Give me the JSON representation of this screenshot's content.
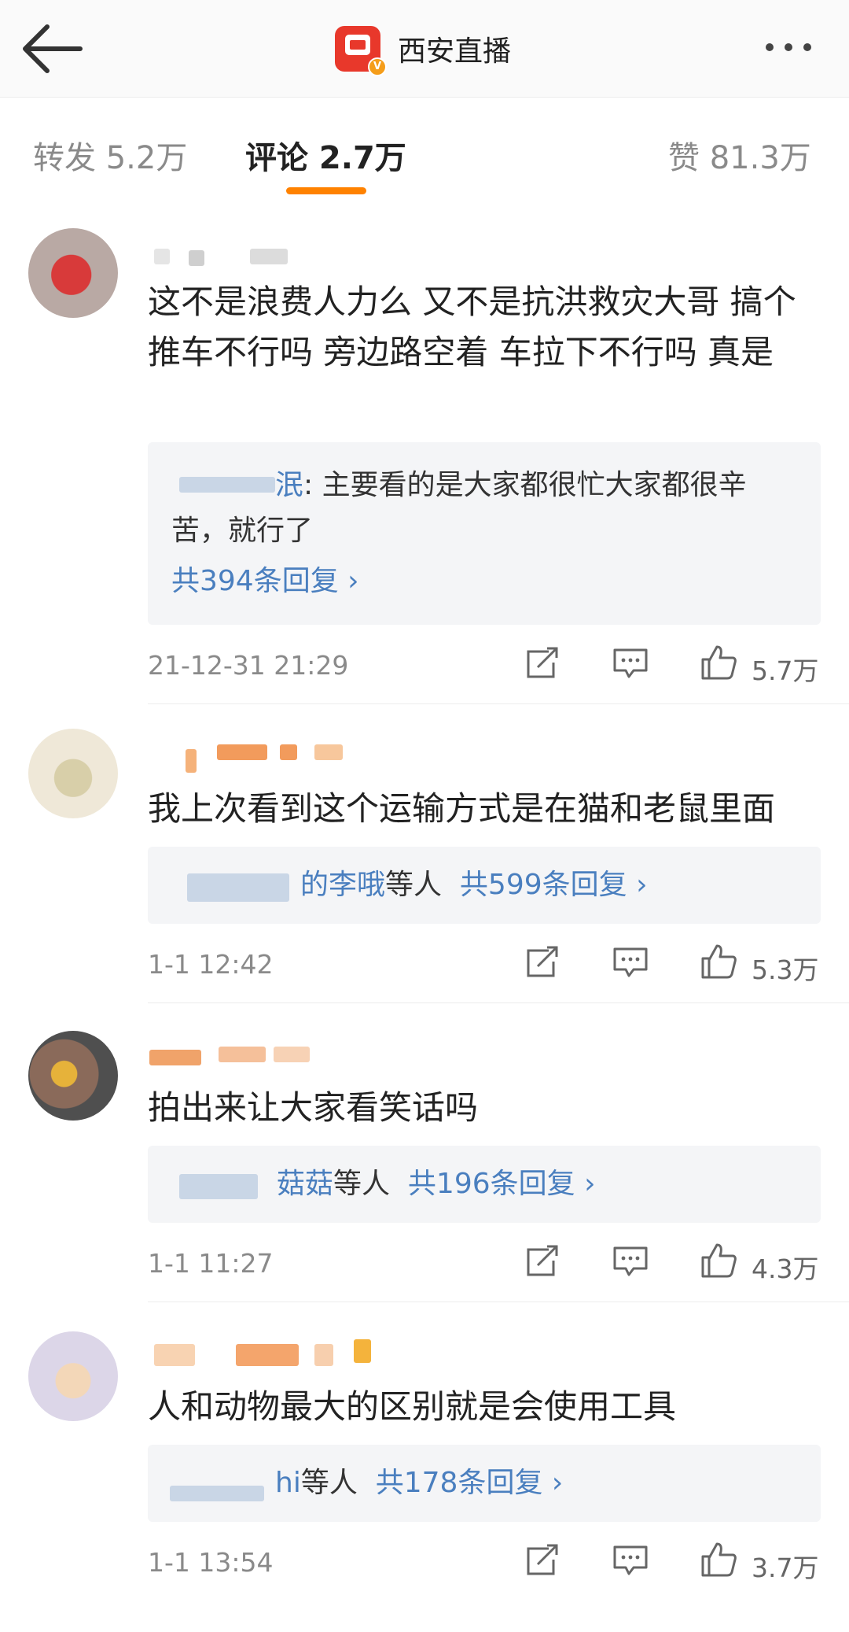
{
  "header": {
    "title": "西安直播",
    "badge": "V"
  },
  "tabs": {
    "repost": "转发 5.2万",
    "comments": "评论 2.7万",
    "likes": "赞 81.3万"
  },
  "comments": [
    {
      "text": "这不是浪费人力么 又不是抗洪救灾大哥 搞个推车不行吗 旁边路空着 车拉下不行吗 真是",
      "reply_name_suffix": "泯",
      "reply_text": ": 主要看的是大家都很忙大家都很辛苦，就行了",
      "reply_more": "共394条回复 ›",
      "time": "21-12-31 21:29",
      "likes": "5.7万"
    },
    {
      "text": "我上次看到这个运输方式是在猫和老鼠里面",
      "reply_name_suffix": "的李哦",
      "reply_others": "等人",
      "reply_more": "共599条回复 ›",
      "time": "1-1 12:42",
      "likes": "5.3万"
    },
    {
      "text": "拍出来让大家看笑话吗",
      "reply_name_suffix": "菇菇",
      "reply_others": "等人",
      "reply_more": "共196条回复 ›",
      "time": "1-1 11:27",
      "likes": "4.3万"
    },
    {
      "text": "人和动物最大的区别就是会使用工具",
      "reply_name_suffix": "hi",
      "reply_others": "等人",
      "reply_more": "共178条回复 ›",
      "time": "1-1 13:54",
      "likes": "3.7万"
    }
  ],
  "colors": {
    "accent": "#ff8200",
    "link": "#4a7fbf",
    "logo": "#e8382b"
  }
}
